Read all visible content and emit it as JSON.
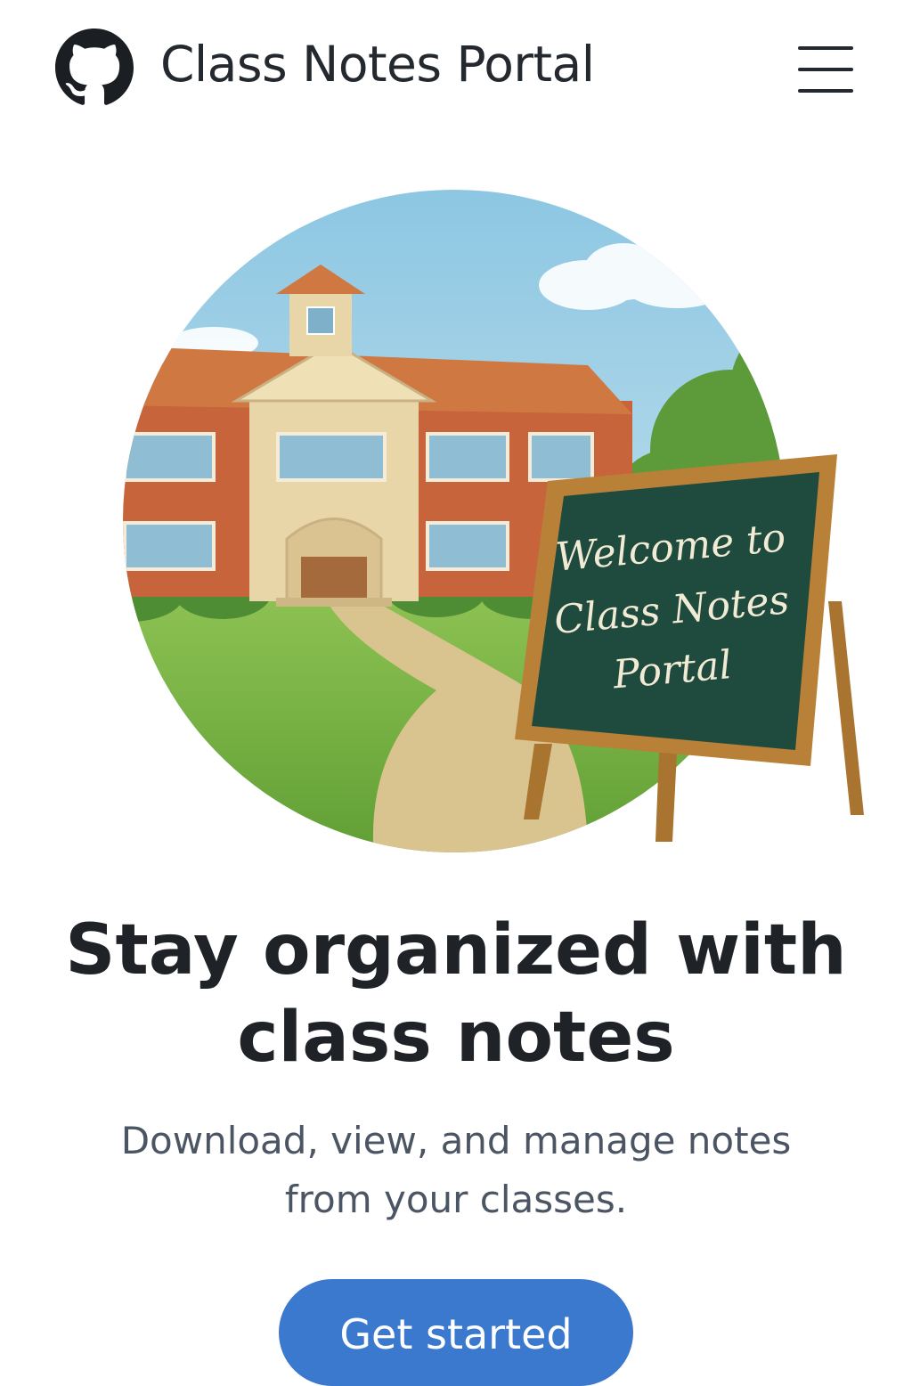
{
  "header": {
    "logo_icon": "octocat-logo-icon",
    "title": "Class Notes Portal",
    "menu_icon": "hamburger-menu-icon"
  },
  "hero": {
    "illustration": "school-building-with-chalkboard",
    "chalkboard_text": [
      "Welcome to",
      "Class Notes",
      "Portal"
    ]
  },
  "main": {
    "heading_lines": [
      "Stay organized with",
      "class notes"
    ],
    "subtitle_lines": [
      "Download, view, and manage notes",
      "from your classes."
    ],
    "cta_label": "Get started"
  },
  "colors": {
    "primary": "#3b79cf",
    "text_dark": "#1f2328",
    "text_muted": "#4b5563",
    "chalkboard": "#1f4a3e",
    "brick": "#c8643c",
    "grass": "#7cb342",
    "sky": "#a9d3ea"
  }
}
